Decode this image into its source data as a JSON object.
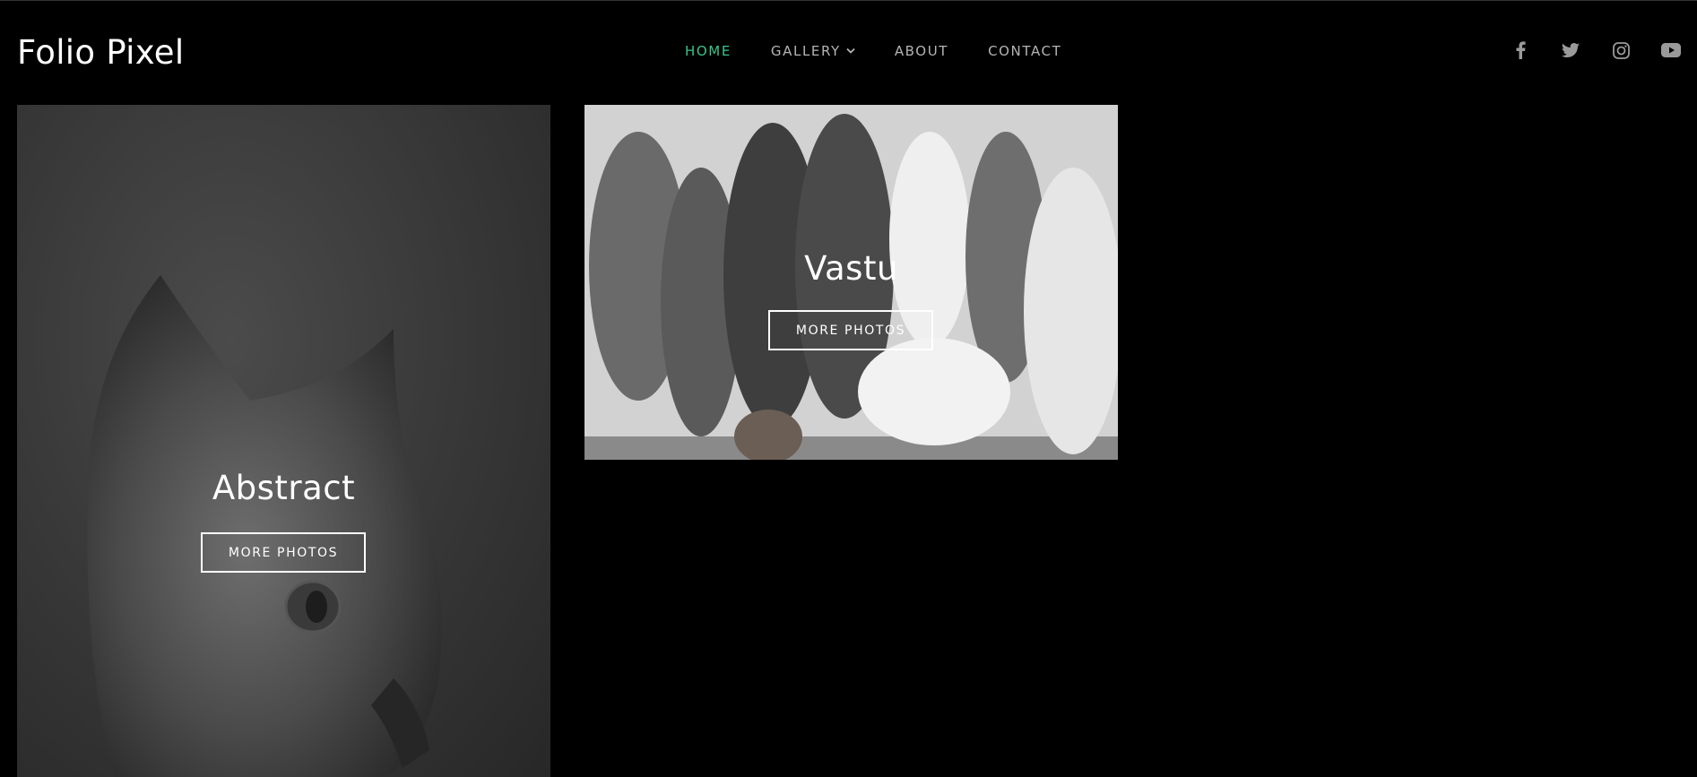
{
  "brand": {
    "name": "Folio Pixel"
  },
  "nav": {
    "items": [
      {
        "label": "HOME",
        "active": true
      },
      {
        "label": "GALLERY",
        "has_dropdown": true
      },
      {
        "label": "ABOUT"
      },
      {
        "label": "CONTACT"
      }
    ]
  },
  "colors": {
    "background": "#000000",
    "nav_active": "#39c48b",
    "nav_default": "#b4b4b4",
    "text": "#ffffff"
  },
  "social": {
    "icons": [
      "facebook-icon",
      "twitter-icon",
      "instagram-icon",
      "youtube-icon"
    ]
  },
  "gallery": {
    "cards": [
      {
        "title": "Abstract",
        "button_label": "MORE PHOTOS",
        "image": "black-and-white kitten profile"
      },
      {
        "title": "Vastu",
        "button_label": "MORE PHOTOS",
        "image": "black-and-white ceremony group photo"
      }
    ]
  }
}
